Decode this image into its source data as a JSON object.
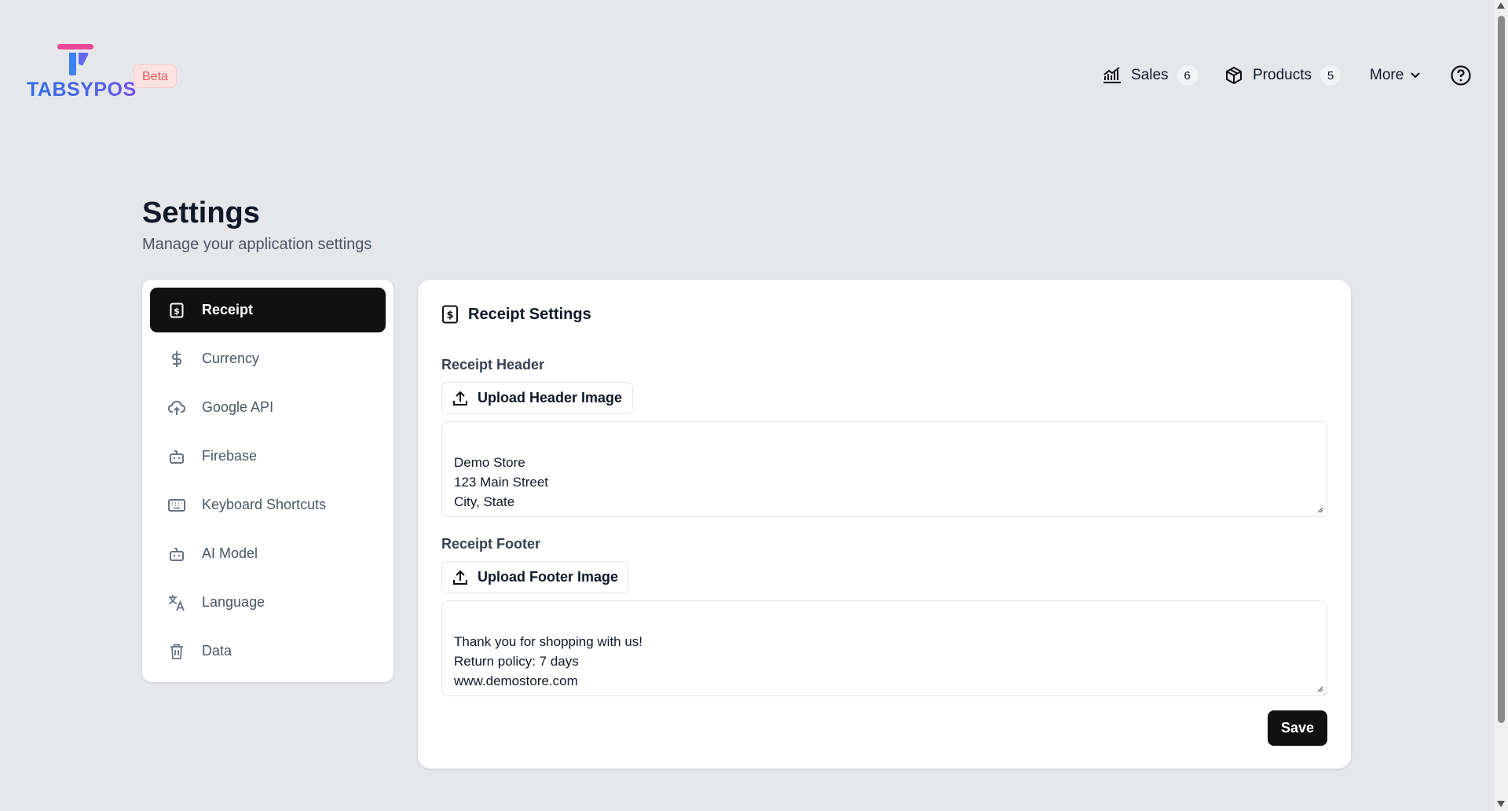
{
  "header": {
    "logo_text": "TABSYPOS",
    "badge": "Beta",
    "nav": {
      "sales_label": "Sales",
      "sales_count": "6",
      "products_label": "Products",
      "products_count": "5",
      "more_label": "More"
    }
  },
  "page": {
    "title": "Settings",
    "subtitle": "Manage your application settings"
  },
  "sidebar": {
    "items": [
      {
        "label": "Receipt",
        "icon": "receipt-icon"
      },
      {
        "label": "Currency",
        "icon": "dollar-icon"
      },
      {
        "label": "Google API",
        "icon": "cloud-upload-icon"
      },
      {
        "label": "Firebase",
        "icon": "bot-icon"
      },
      {
        "label": "Keyboard Shortcuts",
        "icon": "keyboard-icon"
      },
      {
        "label": "AI Model",
        "icon": "bot-icon"
      },
      {
        "label": "Language",
        "icon": "translate-icon"
      },
      {
        "label": "Data",
        "icon": "trash-icon"
      }
    ]
  },
  "receipt": {
    "title": "Receipt Settings",
    "header_label": "Receipt Header",
    "upload_header": "Upload Header Image",
    "header_text": "Demo Store\n123 Main Street\nCity, State",
    "footer_label": "Receipt Footer",
    "upload_footer": "Upload Footer Image",
    "footer_text": "Thank you for shopping with us!\nReturn policy: 7 days\nwww.demostore.com",
    "save_label": "Save"
  },
  "colors": {
    "background": "#e5e7eb",
    "active": "#111111",
    "logo_pink": "#ec4899",
    "logo_blue": "#3b82f6",
    "beta_bg": "#fde2e2",
    "beta_text": "#e15b5b"
  }
}
